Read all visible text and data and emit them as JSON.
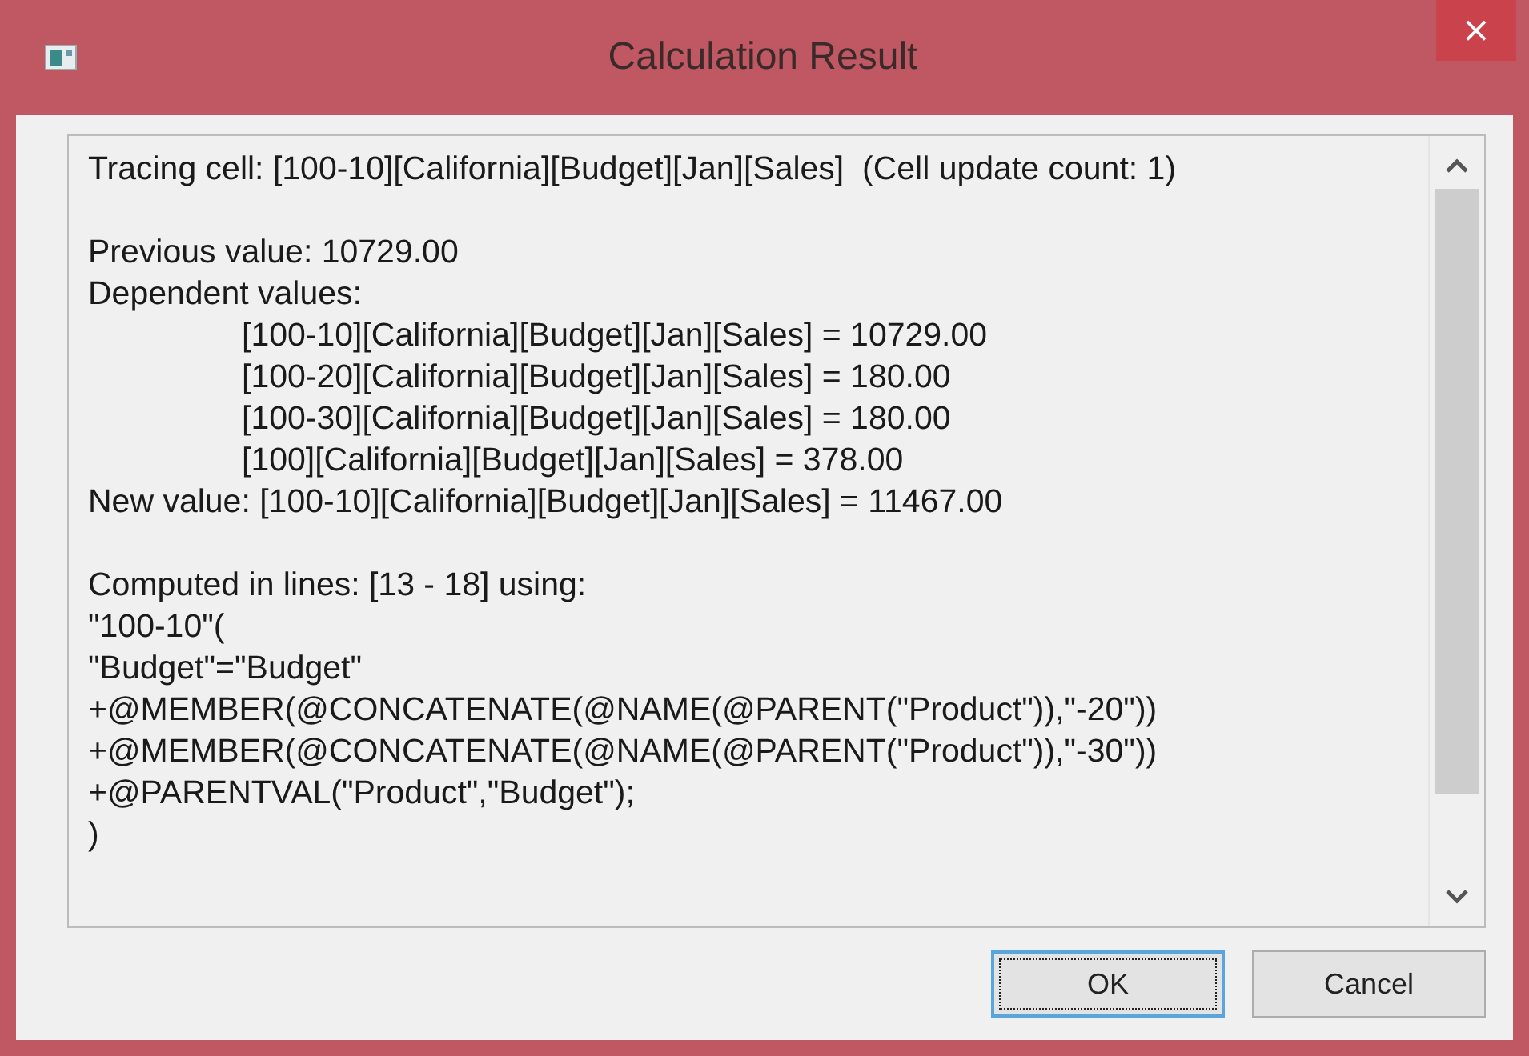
{
  "window": {
    "title": "Calculation Result",
    "close": "×"
  },
  "output": {
    "blocks": [
      [
        {
          "text": "Tracing cell: [100-10][California][Budget][Jan][Sales]  (Cell update count: 1)",
          "indented": false
        }
      ],
      [
        {
          "text": "Previous value: 10729.00",
          "indented": false
        },
        {
          "text": "Dependent values:",
          "indented": false
        },
        {
          "text": "[100-10][California][Budget][Jan][Sales] = 10729.00",
          "indented": true
        },
        {
          "text": "[100-20][California][Budget][Jan][Sales] = 180.00",
          "indented": true
        },
        {
          "text": "[100-30][California][Budget][Jan][Sales] = 180.00",
          "indented": true
        },
        {
          "text": "[100][California][Budget][Jan][Sales] = 378.00",
          "indented": true
        },
        {
          "text": "New value: [100-10][California][Budget][Jan][Sales] = 11467.00",
          "indented": false
        }
      ],
      [
        {
          "text": "Computed in lines: [13 - 18] using:",
          "indented": false
        },
        {
          "text": "\"100-10\"(",
          "indented": false
        },
        {
          "text": "\"Budget\"=\"Budget\"",
          "indented": false
        },
        {
          "text": "+@MEMBER(@CONCATENATE(@NAME(@PARENT(\"Product\")),\"-20\"))",
          "indented": false
        },
        {
          "text": "+@MEMBER(@CONCATENATE(@NAME(@PARENT(\"Product\")),\"-30\"))",
          "indented": false
        },
        {
          "text": "+@PARENTVAL(\"Product\",\"Budget\");",
          "indented": false
        },
        {
          "text": ")",
          "indented": false
        }
      ]
    ]
  },
  "buttons": [
    {
      "label": "OK",
      "selected": true
    },
    {
      "label": "Cancel",
      "selected": false
    }
  ]
}
